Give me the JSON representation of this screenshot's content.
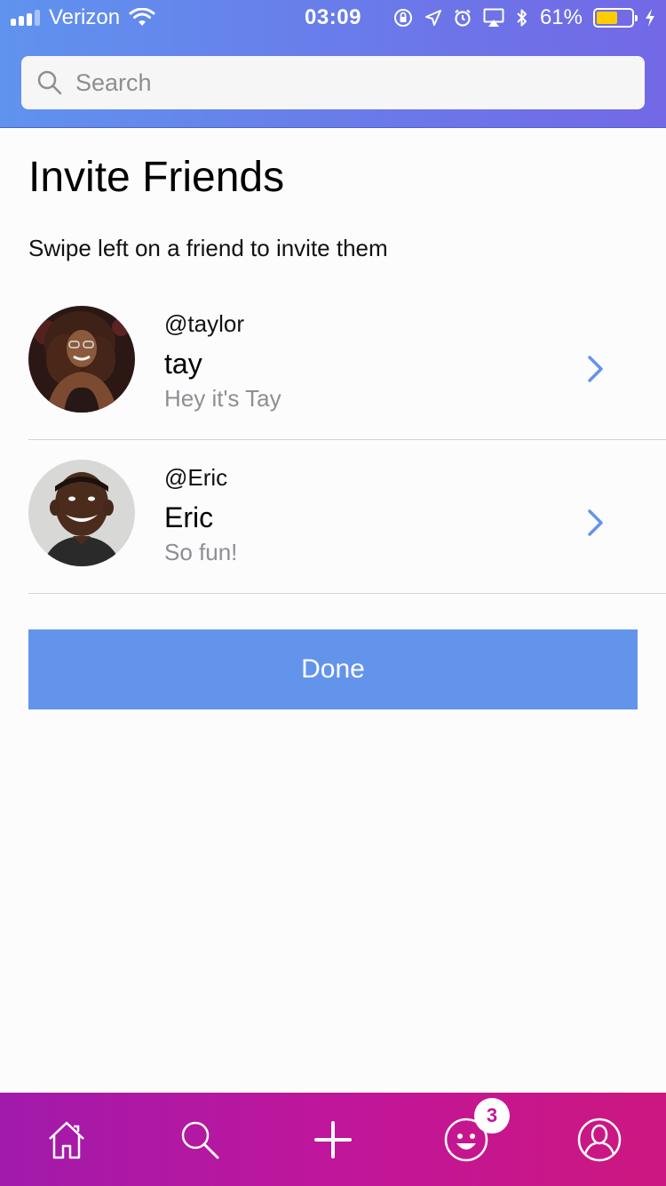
{
  "status_bar": {
    "carrier": "Verizon",
    "time": "03:09",
    "battery_percent": "61%",
    "battery_level": 0.61,
    "battery_color": "#ffcc00"
  },
  "search": {
    "placeholder": "Search"
  },
  "page": {
    "title": "Invite Friends",
    "subtitle": "Swipe left on a friend to invite them"
  },
  "friends": [
    {
      "handle": "@taylor",
      "name": "tay",
      "bio": "Hey it's Tay"
    },
    {
      "handle": "@Eric",
      "name": "Eric",
      "bio": "So fun!"
    }
  ],
  "done_button": {
    "label": "Done",
    "color": "#6394ec"
  },
  "tab_bar": {
    "tabs": [
      "home-icon",
      "search-icon",
      "plus-icon",
      "smiley-icon",
      "profile-icon"
    ],
    "badge_count": "3"
  },
  "colors": {
    "accent": "#6394ec",
    "header_gradient": [
      "#5f93ee",
      "#7368e6"
    ],
    "tabbar_gradient": [
      "#a11aab",
      "#cd1780"
    ]
  }
}
